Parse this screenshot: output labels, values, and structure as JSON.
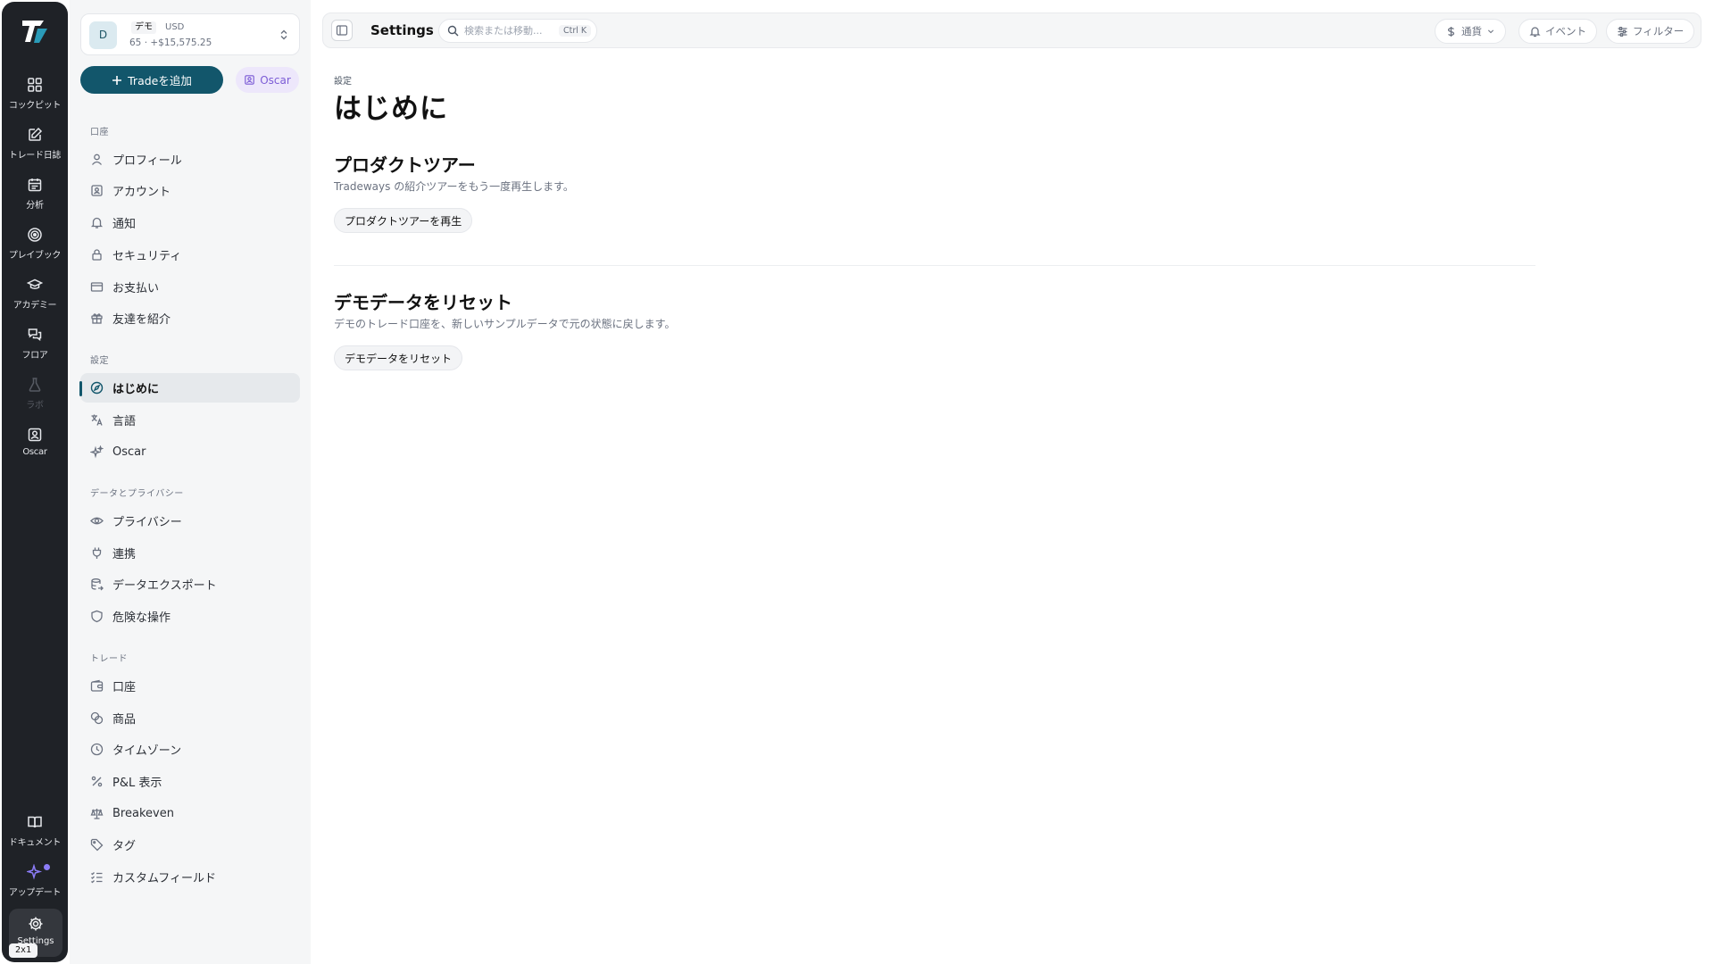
{
  "rail": {
    "items": [
      {
        "label": "コックピット",
        "icon": "dashboard-icon"
      },
      {
        "label": "トレード日誌",
        "icon": "journal-icon"
      },
      {
        "label": "分析",
        "icon": "calendar-icon"
      },
      {
        "label": "プレイブック",
        "icon": "target-icon"
      },
      {
        "label": "アカデミー",
        "icon": "graduation-cap-icon"
      },
      {
        "label": "フロア",
        "icon": "chat-icon"
      },
      {
        "label": "ラボ",
        "icon": "flask-icon"
      },
      {
        "label": "Oscar",
        "icon": "oscar-icon"
      }
    ],
    "bottom": [
      {
        "label": "ドキュメント",
        "icon": "book-icon"
      },
      {
        "label": "アップデート",
        "icon": "sparkle-icon"
      }
    ],
    "settings_label": "Settings",
    "resolution_badge": "2x1"
  },
  "account": {
    "avatar": "D",
    "tag": "デモ",
    "currency": "USD",
    "balance": "65 · +$15,575.25"
  },
  "actions": {
    "add_trade": "Tradeを追加",
    "oscar": "Oscar"
  },
  "nav": {
    "sections": [
      {
        "heading": "口座",
        "items": [
          "プロフィール",
          "アカウント",
          "通知",
          "セキュリティ",
          "お支払い",
          "友達を紹介"
        ]
      },
      {
        "heading": "設定",
        "items": [
          "はじめに",
          "言語",
          "Oscar"
        ]
      },
      {
        "heading": "データとプライバシー",
        "items": [
          "プライバシー",
          "連携",
          "データエクスポート",
          "危険な操作"
        ]
      },
      {
        "heading": "トレード",
        "items": [
          "口座",
          "商品",
          "タイムゾーン",
          "P&L 表示",
          "Breakeven",
          "タグ",
          "カスタムフィールド"
        ]
      }
    ],
    "active": "はじめに"
  },
  "topbar": {
    "title": "Settings",
    "search_placeholder": "検索または移動...",
    "shortcut": "Ctrl K",
    "currency": "通貨",
    "events": "イベント",
    "filter": "フィルター"
  },
  "page": {
    "breadcrumb": "設定",
    "title": "はじめに",
    "sections": [
      {
        "title": "プロダクトツアー",
        "desc": "Tradeways の紹介ツアーをもう一度再生します。",
        "button": "プロダクトツアーを再生"
      },
      {
        "title": "デモデータをリセット",
        "desc": "デモのトレード口座を、新しいサンプルデータで元の状態に戻します。",
        "button": "デモデータをリセット"
      }
    ]
  },
  "colors": {
    "accent": "#12566b",
    "rail_bg": "#1f2227",
    "sidebar_bg": "#f5f6f7",
    "oscar_purple": "#7c5cd6"
  }
}
